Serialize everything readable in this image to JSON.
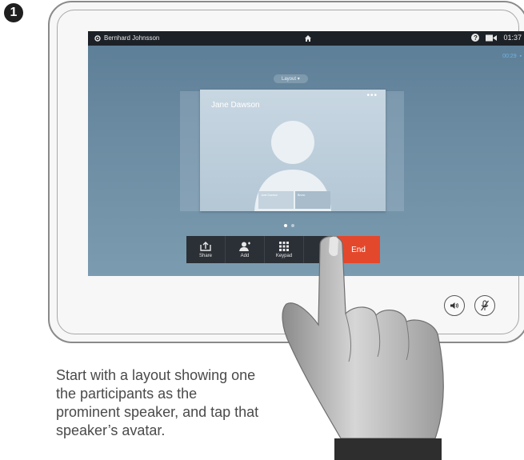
{
  "step": {
    "number": "1"
  },
  "statusbar": {
    "user_name": "Bernhard Johnsson",
    "time": "01:37",
    "call_duration": "00:29"
  },
  "layout_button": {
    "label": "Layout"
  },
  "main_tile": {
    "participant_name": "Jane Dawson"
  },
  "thumbnails": [
    {
      "label": "Jane Dawson"
    },
    {
      "label": "Bruno"
    }
  ],
  "controls": {
    "share_label": "Share",
    "add_label": "Add",
    "keypad_label": "Keypad",
    "end_label": "End"
  },
  "caption": {
    "text": "Start with a layout showing one the participants as the prominent speaker, and tap that speaker’s avatar."
  },
  "colors": {
    "end_button": "#e4482c",
    "timer": "#6fb3e8",
    "statusbar": "#1c2127"
  }
}
